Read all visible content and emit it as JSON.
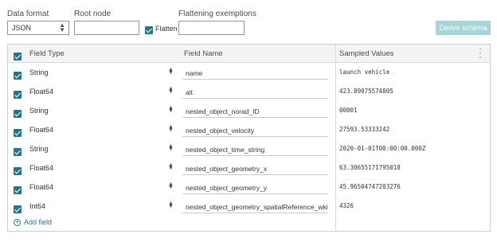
{
  "top": {
    "data_format_label": "Data format",
    "data_format_value": "JSON",
    "root_node_label": "Root node",
    "root_node_value": "",
    "flatten_label": "Flatten",
    "flatten_checked": true,
    "exemptions_label": "Flattening exemptions",
    "exemptions_value": "",
    "derive_button": "Derive schema"
  },
  "table": {
    "headers": {
      "field_type": "Field Type",
      "field_name": "Field Name",
      "sampled_values": "Sampled Values"
    },
    "rows": [
      {
        "type": "String",
        "name": "name",
        "sample": "launch vehicle"
      },
      {
        "type": "Float64",
        "name": "alt",
        "sample": "423.89075574805"
      },
      {
        "type": "String",
        "name": "nested_object_norad_ID",
        "sample": "00001"
      },
      {
        "type": "Float64",
        "name": "nested_object_velocity",
        "sample": "27593.53333242"
      },
      {
        "type": "String",
        "name": "nested_object_time_string",
        "sample": "2020-01-01T00:00:00.000Z"
      },
      {
        "type": "Float64",
        "name": "nested_object_geometry_x",
        "sample": "63.30655171795018"
      },
      {
        "type": "Float64",
        "name": "nested_object_geometry_y",
        "sample": "45.96504747203276"
      },
      {
        "type": "Int64",
        "name": "nested_object_geometry_spatialReference_wkid",
        "sample": "4326"
      }
    ],
    "add_field": "Add field"
  },
  "colors": {
    "accent": "#1f7a88",
    "derive_disabled": "#a7d4d9"
  }
}
